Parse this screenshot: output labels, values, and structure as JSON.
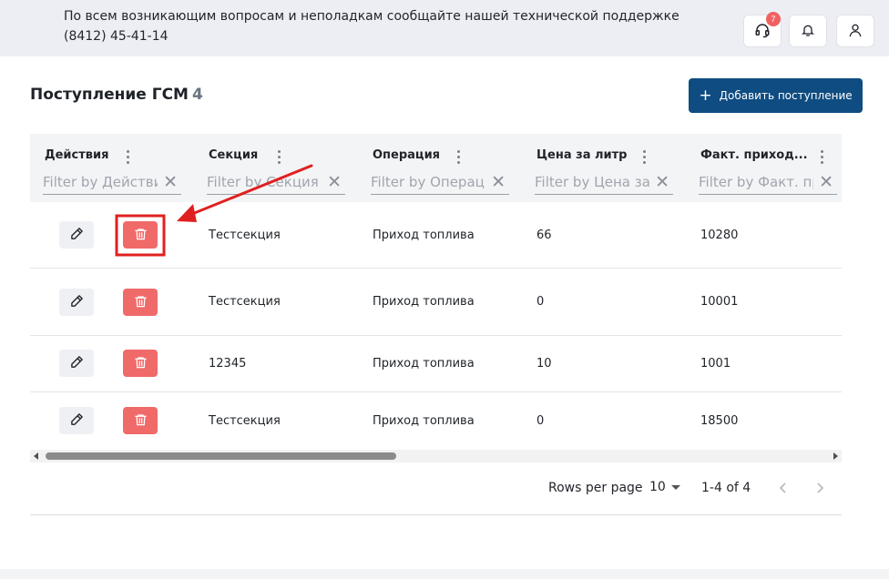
{
  "header": {
    "support_text": "По всем возникающим вопросам и неполадкам сообщайте нашей технической поддержке (8412) 45-41-14",
    "support_badge": "7",
    "icons": [
      "headset-icon",
      "bell-icon",
      "user-icon"
    ]
  },
  "page": {
    "title": "Поступление ГСМ",
    "count": "4",
    "add_label": "Добавить поступление"
  },
  "table": {
    "columns": [
      {
        "title": "Действия",
        "placeholder": "Filter by Действия"
      },
      {
        "title": "Секция",
        "placeholder": "Filter by Секция"
      },
      {
        "title": "Операция",
        "placeholder": "Filter by Операция"
      },
      {
        "title": "Цена за литр",
        "placeholder": "Filter by Цена за литр"
      },
      {
        "title": "Факт. приход...",
        "placeholder": "Filter by Факт. приход"
      }
    ],
    "rows": [
      {
        "section": "Тестсекция",
        "operation": "Приход топлива",
        "price": "66",
        "fact": "10280"
      },
      {
        "section": "Тестсекция",
        "operation": "Приход топлива",
        "price": "0",
        "fact": "10001"
      },
      {
        "section": "12345",
        "operation": "Приход топлива",
        "price": "10",
        "fact": "1001"
      },
      {
        "section": "Тестсекция",
        "operation": "Приход топлива",
        "price": "0",
        "fact": "18500"
      }
    ]
  },
  "pagination": {
    "rows_per_page_label": "Rows per page",
    "rows_per_page_value": "10",
    "range": "1-4 of 4"
  },
  "colors": {
    "primary": "#0f4c81",
    "delete": "#f06a6a",
    "annotation": "#e02020"
  }
}
